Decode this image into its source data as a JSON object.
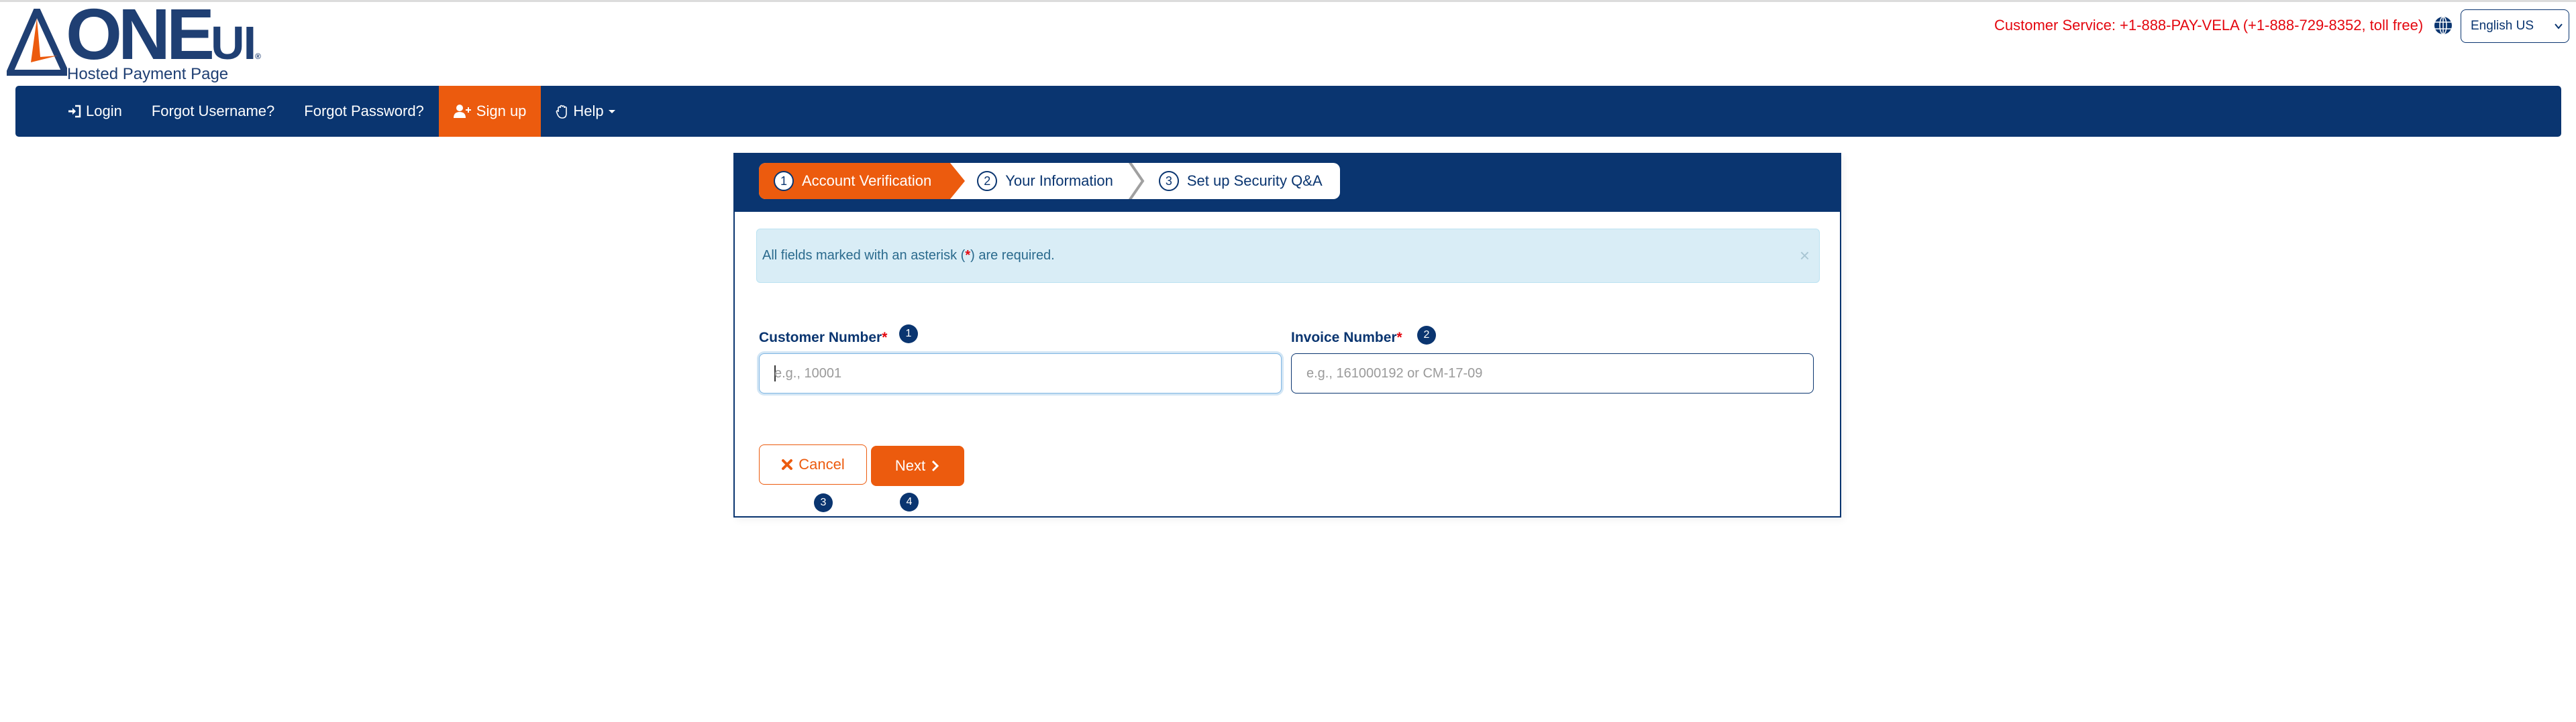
{
  "brand": {
    "logo_name": "ONE",
    "logo_suffix": "UI",
    "logo_reg": "®",
    "subtitle": "Hosted Payment Page",
    "colors": {
      "primary": "#0a3570",
      "accent": "#ec5b0e",
      "alert_red": "#e4070f"
    }
  },
  "header": {
    "customer_service": "Customer Service: +1-888-PAY-VELA (+1-888-729-8352, toll free)",
    "language": {
      "selected": "English US",
      "icon": "globe-icon"
    }
  },
  "nav": {
    "items": [
      {
        "label": "Login",
        "icon": "sign-in-icon",
        "active": false
      },
      {
        "label": "Forgot Username?",
        "active": false
      },
      {
        "label": "Forgot Password?",
        "active": false
      },
      {
        "label": "Sign up",
        "icon": "user-plus-icon",
        "active": true
      },
      {
        "label": "Help",
        "icon": "hand-icon",
        "dropdown": true,
        "active": false
      }
    ]
  },
  "wizard": {
    "steps": [
      {
        "num": "1",
        "label": "Account Verification",
        "active": true
      },
      {
        "num": "2",
        "label": "Your Information",
        "active": false
      },
      {
        "num": "3",
        "label": "Set up Security Q&A",
        "active": false
      }
    ]
  },
  "alert": {
    "text_before": "All fields marked with an asterisk (",
    "asterisk": "*",
    "text_after": ") are required.",
    "close": "×"
  },
  "form": {
    "customer_number": {
      "label": "Customer Number",
      "required": "*",
      "badge": "1",
      "value": "",
      "placeholder": "e.g., 10001"
    },
    "invoice_number": {
      "label": "Invoice Number",
      "required": "*",
      "badge": "2",
      "value": "",
      "placeholder": "e.g., 161000192 or CM-17-09"
    }
  },
  "actions": {
    "cancel": {
      "label": "Cancel",
      "badge": "3",
      "icon": "times-icon"
    },
    "next": {
      "label": "Next",
      "badge": "4",
      "icon": "chevron-right-icon"
    }
  }
}
